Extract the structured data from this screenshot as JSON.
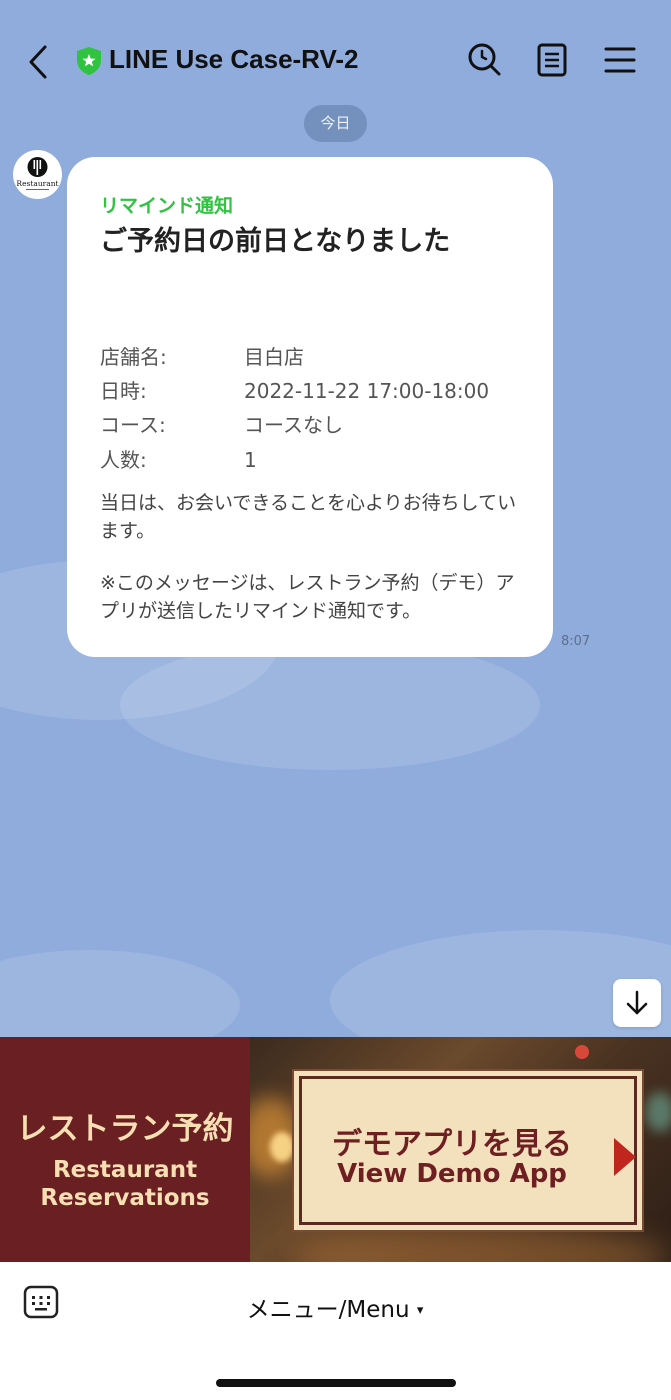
{
  "header": {
    "title": "LINE Use Case-RV-2"
  },
  "chat": {
    "date_label": "今日",
    "avatar_text": "Restaurant",
    "message": {
      "label": "リマインド通知",
      "title": "ご予約日の前日となりました",
      "details": [
        {
          "key": "店舗名:",
          "value": "目白店"
        },
        {
          "key": "日時:",
          "value": "2022-11-22 17:00-18:00"
        },
        {
          "key": "コース:",
          "value": "コースなし"
        },
        {
          "key": "人数:",
          "value": "1"
        }
      ],
      "body1": "当日は、お会いできることを心よりお待ちしています。",
      "body2": "※このメッセージは、レストラン予約（デモ）アプリが送信したリマインド通知です。",
      "time": "8:07"
    }
  },
  "rich_menu": {
    "left_jp": "レストラン予約",
    "left_en1": "Restaurant",
    "left_en2": "Reservations",
    "button_jp": "デモアプリを見る",
    "button_en": "View Demo App"
  },
  "bottom": {
    "menu_label": "メニュー/Menu",
    "menu_caret": "▾"
  },
  "colors": {
    "chat_background": "#8facdc",
    "label_green": "#2fc33f",
    "banner_red": "#6a1f22",
    "demo_text": "#6e1f22",
    "arrow_red": "#c0251e"
  },
  "icons": [
    "back-icon",
    "shield-icon",
    "search-icon",
    "notes-icon",
    "menu-icon",
    "arrow-down-icon",
    "keyboard-icon"
  ]
}
